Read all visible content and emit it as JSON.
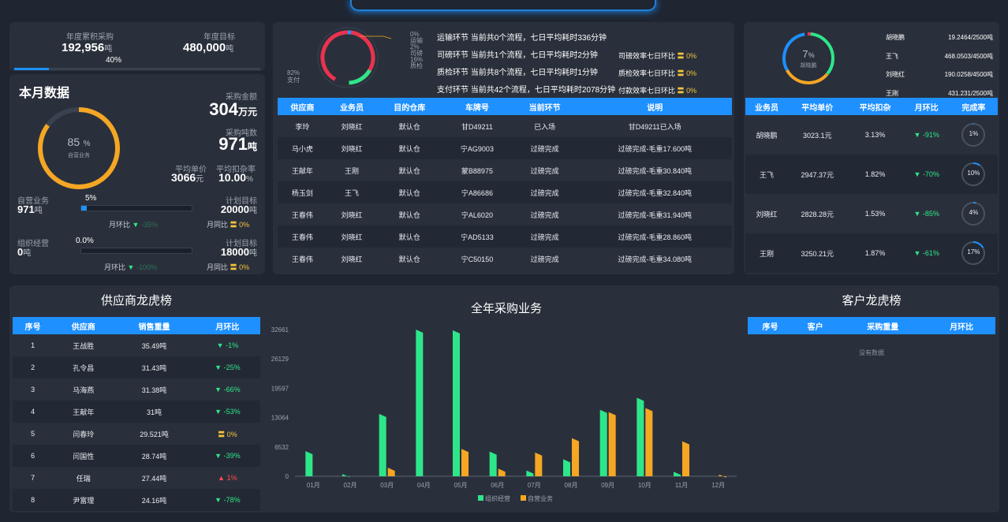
{
  "summary": {
    "annual_purchase_label": "年度累积采购",
    "annual_purchase_value": "192,956",
    "annual_purchase_unit": "吨",
    "annual_percent": "40%",
    "annual_target_label": "年度目标",
    "annual_target_value": "480,000",
    "annual_target_unit": "吨",
    "annual_progress": 0.4
  },
  "monthly": {
    "title": "本月数据",
    "amount_label": "采购金额",
    "amount_value": "304",
    "amount_unit": "万元",
    "tons_label": "采购吨数",
    "tons_value": "971",
    "tons_unit": "吨",
    "avg_price_label": "平均单价",
    "avg_price_value": "3066",
    "avg_price_unit": "元",
    "deduct_label": "平均扣杂率",
    "deduct_value": "10.00",
    "deduct_unit": "%",
    "ring_value": "85",
    "ring_unit": "%",
    "ring_label": "自营业务",
    "ring_fraction": 0.85,
    "self_label": "自营业务",
    "self_value": "971",
    "self_unit": "吨",
    "self_percent": "5%",
    "self_fraction": 0.05,
    "self_plan_label": "计划目标",
    "self_plan_value": "20000",
    "self_plan_unit": "吨",
    "self_mom_label": "月环比",
    "self_mom_value": "-35%",
    "self_yoy_label": "月同比",
    "self_yoy_value": "0%",
    "org_label": "组织经营",
    "org_value": "0",
    "org_unit": "吨",
    "org_percent": "0.0%",
    "org_fraction": 0,
    "org_plan_label": "计划目标",
    "org_plan_value": "18000",
    "org_plan_unit": "吨",
    "org_mom_label": "月环比",
    "org_mom_value": "-100%",
    "org_yoy_label": "月同比",
    "org_yoy_value": "0%"
  },
  "flow": {
    "donut_labels": [
      {
        "pct": "0%",
        "name": "运输"
      },
      {
        "pct": "2%",
        "name": "司磅"
      },
      {
        "pct": "16%",
        "name": "质检"
      },
      {
        "pct": "82%",
        "name": "支付"
      }
    ],
    "stages": [
      {
        "text": "运输环节 当前共0个流程，七日平均耗时336分钟",
        "eff_label": "",
        "eff_value": ""
      },
      {
        "text": "司磅环节 当前共1个流程，七日平均耗时2分钟",
        "eff_label": "司磅效率七日环比",
        "eff_value": "0%"
      },
      {
        "text": "质检环节 当前共8个流程，七日平均耗时1分钟",
        "eff_label": "质检效率七日环比",
        "eff_value": "0%"
      },
      {
        "text": "支付环节 当前共42个流程，七日平均耗时2078分钟",
        "eff_label": "付款效率七日环比",
        "eff_value": "0%"
      }
    ],
    "headers": [
      "供应商",
      "业务员",
      "目的仓库",
      "车牌号",
      "当前环节",
      "说明"
    ],
    "rows": [
      [
        "李玲",
        "刘晓红",
        "默认仓",
        "甘D49211",
        "已入场",
        "甘D49211已入场"
      ],
      [
        "马小虎",
        "刘晓红",
        "默认仓",
        "宁AG9003",
        "过磅完成",
        "过磅完成-毛重17.600吨"
      ],
      [
        "王献年",
        "王刚",
        "默认仓",
        "蒙B88975",
        "过磅完成",
        "过磅完成-毛重30.840吨"
      ],
      [
        "杨玉剑",
        "王飞",
        "默认仓",
        "宁A86686",
        "过磅完成",
        "过磅完成-毛重32.840吨"
      ],
      [
        "王春伟",
        "刘晓红",
        "默认仓",
        "宁AL6020",
        "过磅完成",
        "过磅完成-毛重31.940吨"
      ],
      [
        "王春伟",
        "刘晓红",
        "默认仓",
        "宁AD5133",
        "过磅完成",
        "过磅完成-毛重28.860吨"
      ],
      [
        "王春伟",
        "刘晓红",
        "默认仓",
        "宁C50150",
        "过磅完成",
        "过磅完成-毛重34.080吨"
      ]
    ]
  },
  "salesmen": {
    "ring_value": "7",
    "ring_unit": "%",
    "ring_label": "胡晓鹏",
    "ring_fraction": 0.07,
    "targets": [
      {
        "name": "胡晓鹏",
        "value": "19.2464/2500吨"
      },
      {
        "name": "王飞",
        "value": "468.0503/4500吨"
      },
      {
        "name": "刘晓红",
        "value": "190.0258/4500吨"
      },
      {
        "name": "王刚",
        "value": "431.231/2500吨"
      }
    ],
    "headers": [
      "业务员",
      "平均单价",
      "平均扣杂",
      "月环比",
      "完成率"
    ],
    "rows": [
      {
        "name": "胡晓鹏",
        "price": "3023.1元",
        "deduct": "3.13%",
        "mom": "-91%",
        "rate": "1%",
        "frac": 0.01
      },
      {
        "name": "王飞",
        "price": "2947.37元",
        "deduct": "1.82%",
        "mom": "-70%",
        "rate": "10%",
        "frac": 0.1
      },
      {
        "name": "刘晓红",
        "price": "2828.28元",
        "deduct": "1.53%",
        "mom": "-85%",
        "rate": "4%",
        "frac": 0.04
      },
      {
        "name": "王刚",
        "price": "3250.21元",
        "deduct": "1.87%",
        "mom": "-61%",
        "rate": "17%",
        "frac": 0.17
      }
    ]
  },
  "supplier_rank": {
    "title": "供应商龙虎榜",
    "headers": [
      "序号",
      "供应商",
      "销售重量",
      "月环比"
    ],
    "rows": [
      {
        "no": "1",
        "name": "王战胜",
        "weight": "35.49吨",
        "mom": "-1%",
        "dir": "down"
      },
      {
        "no": "2",
        "name": "孔令昌",
        "weight": "31.43吨",
        "mom": "-25%",
        "dir": "down"
      },
      {
        "no": "3",
        "name": "马海燕",
        "weight": "31.38吨",
        "mom": "-66%",
        "dir": "down"
      },
      {
        "no": "4",
        "name": "王献年",
        "weight": "31吨",
        "mom": "-53%",
        "dir": "down"
      },
      {
        "no": "5",
        "name": "闫春玲",
        "weight": "29.521吨",
        "mom": "0%",
        "dir": "flat"
      },
      {
        "no": "6",
        "name": "闫国性",
        "weight": "28.74吨",
        "mom": "-39%",
        "dir": "down"
      },
      {
        "no": "7",
        "name": "任瑞",
        "weight": "27.44吨",
        "mom": "1%",
        "dir": "up"
      },
      {
        "no": "8",
        "name": "尹富理",
        "weight": "24.16吨",
        "mom": "-78%",
        "dir": "down"
      }
    ]
  },
  "customer_rank": {
    "title": "客户龙虎榜",
    "headers": [
      "序号",
      "客户",
      "采购重量",
      "月环比"
    ],
    "empty": "没有数据"
  },
  "colors": {
    "accent": "#1e90ff",
    "green": "#2ee68a",
    "orange": "#f5a623",
    "red": "#ff4d4f",
    "yellow": "#f5c23d"
  },
  "chart_data": {
    "type": "bar",
    "title": "全年采购业务",
    "categories": [
      "01月",
      "02月",
      "03月",
      "04月",
      "05月",
      "06月",
      "07月",
      "08月",
      "09月",
      "10月",
      "11月",
      "12月"
    ],
    "series": [
      {
        "name": "组织经营",
        "color": "#2ee68a",
        "values": [
          5600,
          500,
          13900,
          32661,
          32500,
          5500,
          1300,
          3800,
          14800,
          17500,
          1000,
          0
        ]
      },
      {
        "name": "自营业务",
        "color": "#f5a623",
        "values": [
          0,
          0,
          1900,
          0,
          6100,
          1700,
          5300,
          8500,
          14300,
          15200,
          7800,
          400
        ]
      }
    ],
    "yticks": [
      "0",
      "6532",
      "13064",
      "19597",
      "26129",
      "32661"
    ],
    "ylim": [
      0,
      32661
    ],
    "legend": "bottom",
    "grid": false
  }
}
